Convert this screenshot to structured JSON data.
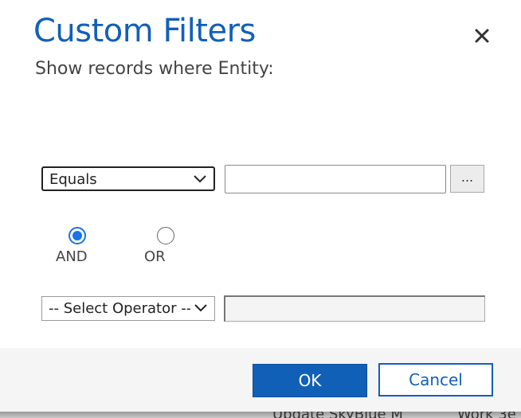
{
  "dialog": {
    "title": "Custom Filters",
    "subtitle": "Show records where Entity:",
    "close_icon": "close-icon"
  },
  "filter1": {
    "operator_selected": "Equals",
    "value": "",
    "lookup_label": "..."
  },
  "logic": {
    "and_label": "AND",
    "or_label": "OR",
    "selected": "AND"
  },
  "filter2": {
    "operator_selected": "-- Select Operator --",
    "value": ""
  },
  "footer": {
    "ok_label": "OK",
    "cancel_label": "Cancel"
  },
  "background": {
    "text1": "Update SkyBlue M",
    "text2": "Work 3e"
  },
  "colors": {
    "accent": "#1160b7",
    "radio_selected": "#1a73e8",
    "footer_bg": "#f5f5f5"
  }
}
